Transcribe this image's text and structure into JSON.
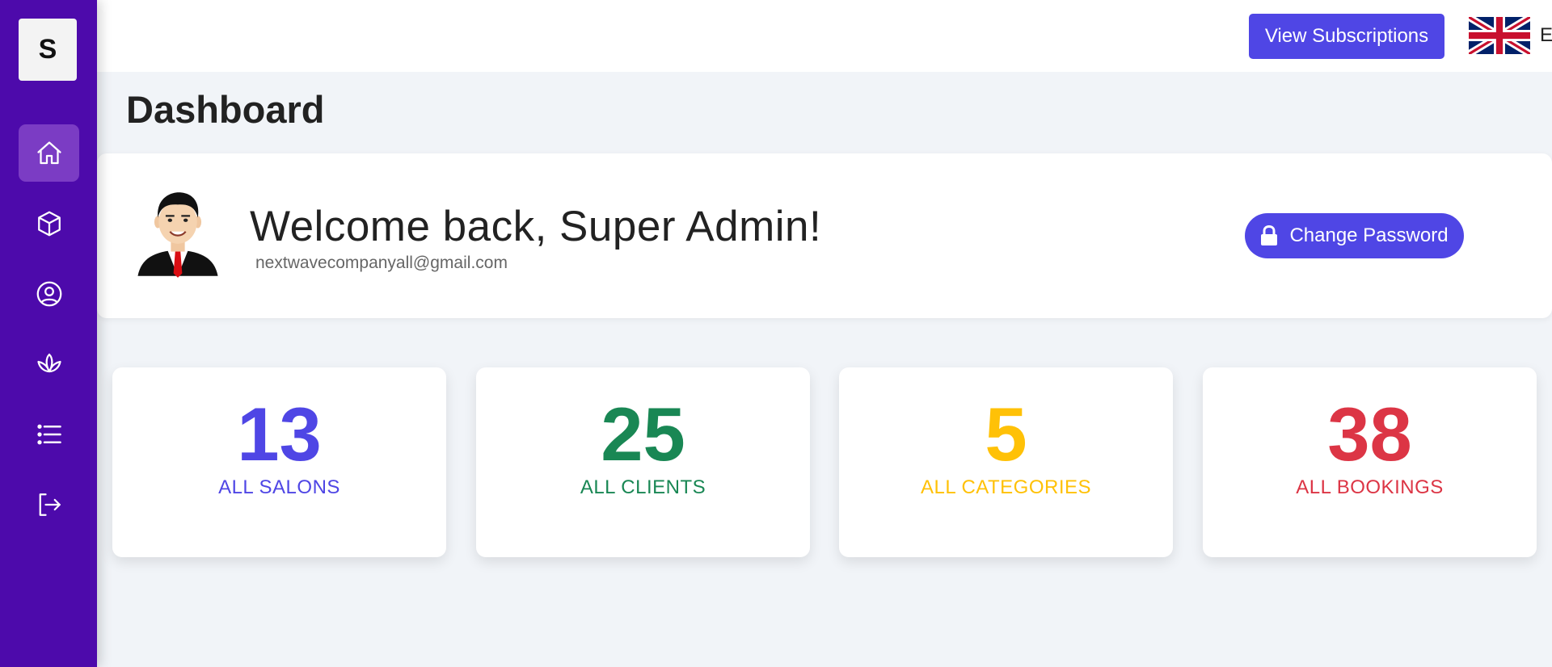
{
  "sidebar": {
    "logo_letter": "S",
    "items": [
      {
        "icon": "home-icon",
        "active": true
      },
      {
        "icon": "box-icon",
        "active": false
      },
      {
        "icon": "user-circle-icon",
        "active": false
      },
      {
        "icon": "lotus-icon",
        "active": false
      },
      {
        "icon": "list-icon",
        "active": false
      },
      {
        "icon": "logout-icon",
        "active": false
      }
    ]
  },
  "topbar": {
    "subscriptions_label": "View Subscriptions",
    "language": "English",
    "flag_icon": "uk-flag-icon"
  },
  "page": {
    "title": "Dashboard"
  },
  "welcome": {
    "greeting": "Welcome back, Super Admin!",
    "email": "nextwavecompanyall@gmail.com",
    "change_password_label": "Change Password"
  },
  "stats": [
    {
      "value": "13",
      "label": "ALL SALONS",
      "color": "#4f46e5"
    },
    {
      "value": "25",
      "label": "ALL CLIENTS",
      "color": "#198754"
    },
    {
      "value": "5",
      "label": "ALL CATEGORIES",
      "color": "#ffc107"
    },
    {
      "value": "38",
      "label": "ALL BOOKINGS",
      "color": "#dc3545"
    }
  ],
  "colors": {
    "sidebar": "#4d0aab",
    "sidebar_active": "#7b3cc4",
    "primary": "#4f46e5",
    "background": "#f1f4f8"
  }
}
